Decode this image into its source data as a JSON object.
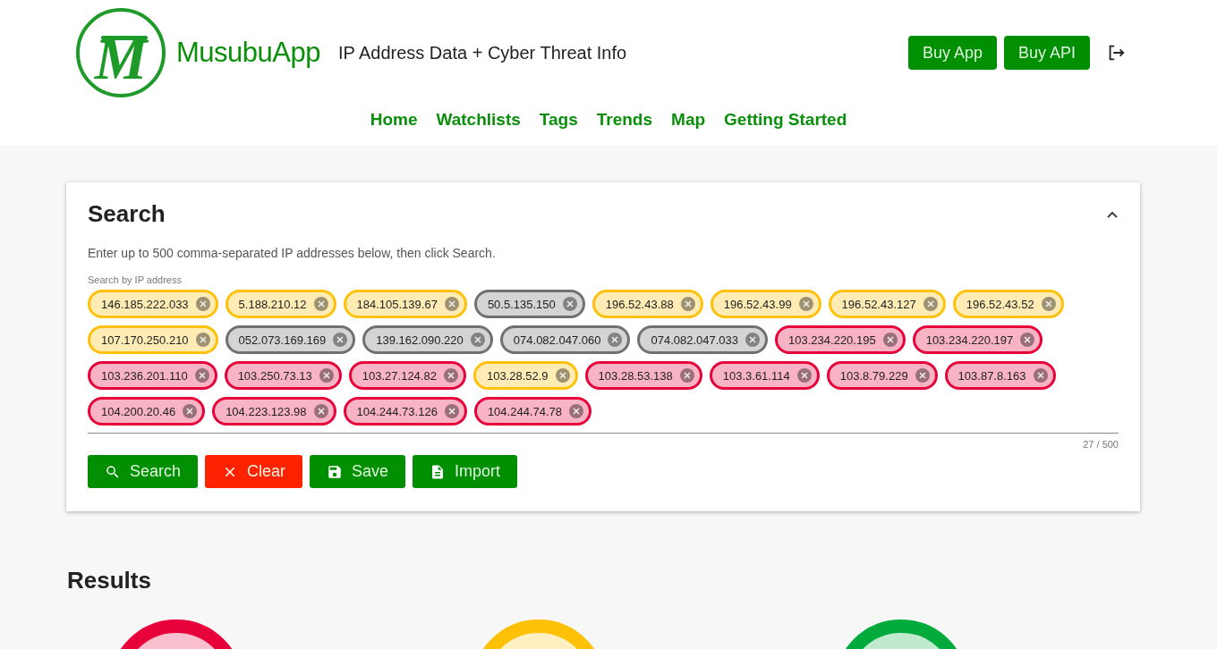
{
  "header": {
    "logo_letter": "M",
    "app_name": "MusubuApp",
    "tagline": "IP Address Data + Cyber Threat Info",
    "buttons": [
      "Buy App",
      "Buy API"
    ]
  },
  "nav": [
    "Home",
    "Watchlists",
    "Tags",
    "Trends",
    "Map",
    "Getting Started"
  ],
  "search": {
    "title": "Search",
    "expanded": true,
    "description": "Enter up to 500 comma-separated IP addresses below, then click Search.",
    "field_label": "Search by IP address",
    "counter": "27 / 500",
    "chips": [
      {
        "label": "146.185.222.033",
        "color": "#ffc107"
      },
      {
        "label": "5.188.210.12",
        "color": "#ffc107"
      },
      {
        "label": "184.105.139.67",
        "color": "#ffc107"
      },
      {
        "label": "50.5.135.150",
        "color": "#707070"
      },
      {
        "label": "196.52.43.88",
        "color": "#ffc107"
      },
      {
        "label": "196.52.43.99",
        "color": "#ffc107"
      },
      {
        "label": "196.52.43.127",
        "color": "#ffc107"
      },
      {
        "label": "196.52.43.52",
        "color": "#ffc107"
      },
      {
        "label": "107.170.250.210",
        "color": "#ffc107"
      },
      {
        "label": "052.073.169.169",
        "color": "#707070"
      },
      {
        "label": "139.162.090.220",
        "color": "#707070"
      },
      {
        "label": "074.082.047.060",
        "color": "#707070"
      },
      {
        "label": "074.082.047.033",
        "color": "#707070"
      },
      {
        "label": "103.234.220.195",
        "color": "#e8003a"
      },
      {
        "label": "103.234.220.197",
        "color": "#e8003a"
      },
      {
        "label": "103.236.201.110",
        "color": "#e8003a"
      },
      {
        "label": "103.250.73.13",
        "color": "#e8003a"
      },
      {
        "label": "103.27.124.82",
        "color": "#e8003a"
      },
      {
        "label": "103.28.52.9",
        "color": "#ffc107"
      },
      {
        "label": "103.28.53.138",
        "color": "#e8003a"
      },
      {
        "label": "103.3.61.114",
        "color": "#e8003a"
      },
      {
        "label": "103.8.79.229",
        "color": "#e8003a"
      },
      {
        "label": "103.87.8.163",
        "color": "#e8003a"
      },
      {
        "label": "104.200.20.46",
        "color": "#e8003a"
      },
      {
        "label": "104.223.123.98",
        "color": "#e8003a"
      },
      {
        "label": "104.244.73.126",
        "color": "#e8003a"
      },
      {
        "label": "104.244.74.78",
        "color": "#e8003a"
      }
    ],
    "actions": [
      {
        "kind": "search",
        "label": "Search"
      },
      {
        "kind": "clear",
        "label": "Clear"
      },
      {
        "kind": "save",
        "label": "Save"
      },
      {
        "kind": "import",
        "label": "Import"
      }
    ]
  },
  "results": {
    "title": "Results",
    "gauges": [
      {
        "color": "#e8003a"
      },
      {
        "color": "#ffc107"
      },
      {
        "color": "#00ab3c"
      }
    ]
  }
}
